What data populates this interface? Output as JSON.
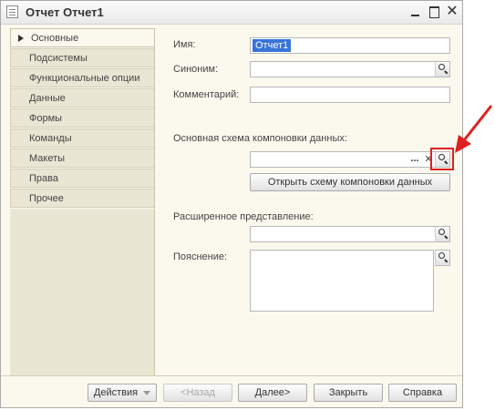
{
  "window": {
    "title": "Отчет Отчет1",
    "min_icon": "minimize-icon",
    "max_icon": "maximize-icon",
    "close_glyph": "✕"
  },
  "sidebar": {
    "items": [
      {
        "label": "Основные",
        "active": true
      },
      {
        "label": "Подсистемы"
      },
      {
        "label": "Функциональные опции"
      },
      {
        "label": "Данные"
      },
      {
        "label": "Формы"
      },
      {
        "label": "Команды"
      },
      {
        "label": "Макеты"
      },
      {
        "label": "Права"
      },
      {
        "label": "Прочее"
      }
    ]
  },
  "form": {
    "name_label": "Имя:",
    "name_value": "Отчет1",
    "synonym_label": "Синоним:",
    "synonym_value": "",
    "comment_label": "Комментарий:",
    "comment_value": "",
    "schema_label": "Основная схема компоновки данных:",
    "schema_value": "",
    "schema_dots": "...",
    "schema_clear": "✕",
    "open_schema_button": "Открыть схему компоновки данных",
    "extended_label": "Расширенное представление:",
    "extended_value": "",
    "explanation_label": "Пояснение:",
    "explanation_value": ""
  },
  "footer": {
    "actions": "Действия",
    "back": "<Назад",
    "next": "Далее>",
    "close": "Закрыть",
    "help": "Справка"
  },
  "colors": {
    "highlight": "#e02020",
    "selection": "#3874d8",
    "panel": "#fbf9ee",
    "tab": "#eae6d4"
  }
}
